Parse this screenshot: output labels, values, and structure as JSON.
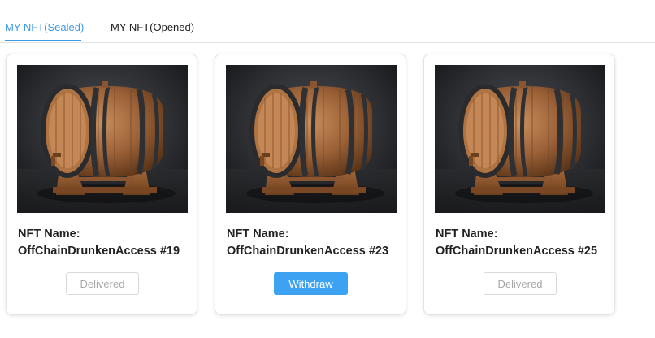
{
  "tabs": [
    {
      "label": "MY NFT(Sealed)",
      "active": true
    },
    {
      "label": "MY NFT(Opened)",
      "active": false
    }
  ],
  "colors": {
    "accent": "#3c9ae8",
    "primary_button": "#3ea2f3",
    "disabled_text": "#a8a8a8"
  },
  "cards": [
    {
      "image_icon": "wine-barrel-image",
      "name_label": "NFT Name:",
      "name": "OffChainDrunkenAccess #19",
      "button_label": "Delivered",
      "button_state": "disabled"
    },
    {
      "image_icon": "wine-barrel-image",
      "name_label": "NFT Name:",
      "name": "OffChainDrunkenAccess #23",
      "button_label": "Withdraw",
      "button_state": "primary"
    },
    {
      "image_icon": "wine-barrel-image",
      "name_label": "NFT Name:",
      "name": "OffChainDrunkenAccess #25",
      "button_label": "Delivered",
      "button_state": "disabled"
    }
  ]
}
